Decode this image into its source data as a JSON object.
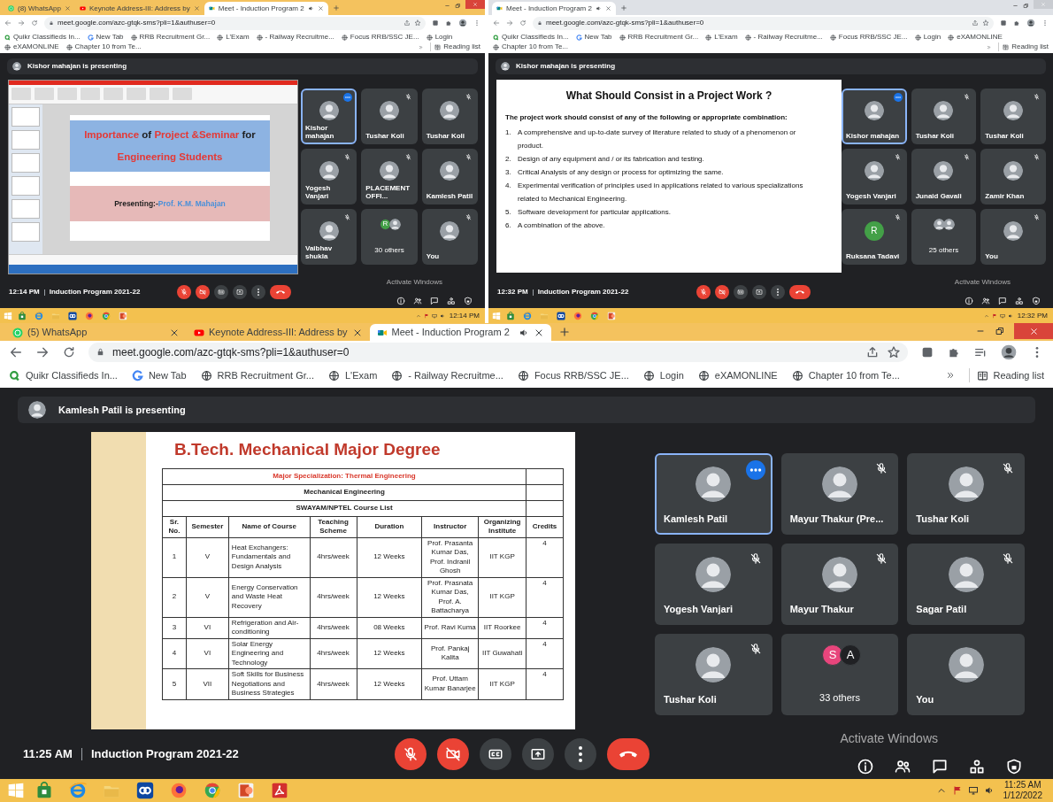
{
  "panels": [
    {
      "tabs": [
        {
          "title": "(8) WhatsApp",
          "kind": "whatsapp",
          "selected": false,
          "audio": false
        },
        {
          "title": "Keynote Address-III: Address by",
          "kind": "youtube",
          "selected": false,
          "audio": false
        },
        {
          "title": "Meet - Induction Program 2",
          "kind": "meet",
          "selected": true,
          "audio": true
        }
      ],
      "url": "meet.google.com/azc-gtqk-sms?pli=1&authuser=0",
      "bookmarks": [
        {
          "label": "Quikr Classifieds In...",
          "kind": "quikr"
        },
        {
          "label": "New Tab",
          "kind": "google"
        },
        {
          "label": "RRB Recruitment Gr...",
          "kind": "globe"
        },
        {
          "label": "L'Exam",
          "kind": "globe"
        },
        {
          "label": "- Railway Recruitme...",
          "kind": "globe"
        },
        {
          "label": "Focus RRB/SSC JE...",
          "kind": "globe"
        },
        {
          "label": "Login",
          "kind": "globe"
        },
        {
          "label": "eXAMONLINE",
          "kind": "globe"
        },
        {
          "label": "Chapter 10 from Te...",
          "kind": "globe"
        }
      ],
      "reading_list": "Reading list",
      "presenter": "Kishor mahajan is presenting",
      "slide": {
        "kind": "title",
        "title_lines": [
          [
            {
              "text": "Importance",
              "color": "#e53935"
            },
            {
              "text": "of",
              "color": "#1f1f1f"
            },
            {
              "text": "Project",
              "color": "#e53935"
            },
            {
              "text": "&Seminar",
              "color": "#e53935"
            },
            {
              "text": "for",
              "color": "#1f1f1f"
            }
          ],
          [
            {
              "text": "Engineering Students",
              "color": "#e53935"
            }
          ]
        ],
        "subtitle": [
          {
            "text": "Presenting:-",
            "color": "#1f1f1f"
          },
          {
            "text": "Prof. K.M. Mahajan",
            "color": "#4a90d9"
          }
        ]
      },
      "tiles": [
        {
          "kind": "photo",
          "name": "Kishor mahajan",
          "speaking": true,
          "muted": false
        },
        {
          "kind": "photo",
          "name": "Tushar Koli",
          "speaking": false,
          "muted": true
        },
        {
          "kind": "photo",
          "name": "Tushar Koli",
          "speaking": false,
          "muted": true
        },
        {
          "kind": "photo",
          "name": "Yogesh Vanjari",
          "speaking": false,
          "muted": true
        },
        {
          "kind": "photo",
          "name": "PLACEMENT OFFI...",
          "speaking": false,
          "muted": true
        },
        {
          "kind": "photo",
          "name": "Kamlesh Patil",
          "speaking": false,
          "muted": true
        },
        {
          "kind": "photo",
          "name": "Vaibhav shukla",
          "speaking": false,
          "muted": true
        },
        {
          "kind": "others",
          "name": "30 others",
          "speaking": false,
          "muted": false,
          "avatars": [
            {
              "kind": "letter",
              "letter": "R",
              "color": "#43a047"
            },
            {
              "kind": "photo"
            }
          ]
        },
        {
          "kind": "photo",
          "name": "You",
          "speaking": false,
          "muted": true
        }
      ],
      "time": "12:14 PM",
      "meeting": "Induction Program 2021-22",
      "mic_on": false,
      "camera_on": false,
      "activation": "Activate Windows",
      "taskbar": {
        "clock": "12:14 PM"
      }
    },
    {
      "tabs": [
        {
          "title": "Meet - Induction Program 2",
          "kind": "meet",
          "selected": true,
          "audio": true
        }
      ],
      "url": "meet.google.com/azc-gtqk-sms?pli=1&authuser=0",
      "bookmarks": [
        {
          "label": "Quikr Classifieds In...",
          "kind": "quikr"
        },
        {
          "label": "New Tab",
          "kind": "google"
        },
        {
          "label": "RRB Recruitment Gr...",
          "kind": "globe"
        },
        {
          "label": "L'Exam",
          "kind": "globe"
        },
        {
          "label": "- Railway Recruitme...",
          "kind": "globe"
        },
        {
          "label": "Focus RRB/SSC JE...",
          "kind": "globe"
        },
        {
          "label": "Login",
          "kind": "globe"
        },
        {
          "label": "eXAMONLINE",
          "kind": "globe"
        },
        {
          "label": "Chapter 10 from Te...",
          "kind": "globe"
        }
      ],
      "reading_list": "Reading list",
      "presenter": "Kishor mahajan is presenting",
      "slide": {
        "kind": "bullets",
        "title": "What Should Consist in a Project Work ?",
        "intro": "The project work should consist of any of the following or appropriate combination:",
        "items": [
          {
            "number": "1.",
            "text": "A comprehensive and up-to-date survey of literature related to study of a phenomenon or product."
          },
          {
            "number": "2.",
            "text": "Design of any equipment and / or its fabrication and testing."
          },
          {
            "number": "3.",
            "text": "Critical Analysis of any design or process for optimizing the same."
          },
          {
            "number": "4.",
            "text": "Experimental verification of principles used in applications related to various specializations related to Mechanical Engineering."
          },
          {
            "number": "5.",
            "text": "Software development for particular applications."
          },
          {
            "number": "6.",
            "text": "A combination of the above."
          }
        ]
      },
      "tiles": [
        {
          "kind": "photo",
          "name": "Kishor mahajan",
          "speaking": true,
          "muted": false
        },
        {
          "kind": "photo",
          "name": "Tushar Koli",
          "speaking": false,
          "muted": true
        },
        {
          "kind": "photo",
          "name": "Tushar Koli",
          "speaking": false,
          "muted": true
        },
        {
          "kind": "photo",
          "name": "Yogesh Vanjari",
          "speaking": false,
          "muted": true
        },
        {
          "kind": "photo",
          "name": "Junaid Gavali",
          "speaking": false,
          "muted": true
        },
        {
          "kind": "photo",
          "name": "Zamir Khan",
          "speaking": false,
          "muted": true
        },
        {
          "kind": "letter",
          "letter": "R",
          "color": "#43a047",
          "name": "Ruksana Tadavi",
          "speaking": false,
          "muted": true
        },
        {
          "kind": "others",
          "name": "25 others",
          "speaking": false,
          "muted": false,
          "avatars": [
            {
              "kind": "photo"
            },
            {
              "kind": "photo"
            }
          ]
        },
        {
          "kind": "photo",
          "name": "You",
          "speaking": false,
          "muted": true
        }
      ],
      "time": "12:32 PM",
      "meeting": "Induction Program 2021-22",
      "mic_on": false,
      "camera_on": false,
      "activation": "Activate Windows",
      "taskbar": {
        "clock": "12:32 PM"
      }
    },
    {
      "tabs": [
        {
          "title": "(5) WhatsApp",
          "kind": "whatsapp",
          "selected": false,
          "audio": false
        },
        {
          "title": "Keynote Address-III: Address by",
          "kind": "youtube",
          "selected": false,
          "audio": false
        },
        {
          "title": "Meet - Induction Program 2",
          "kind": "meet",
          "selected": true,
          "audio": true
        }
      ],
      "url": "meet.google.com/azc-gtqk-sms?pli=1&authuser=0",
      "bookmarks": [
        {
          "label": "Quikr Classifieds In...",
          "kind": "quikr"
        },
        {
          "label": "New Tab",
          "kind": "google"
        },
        {
          "label": "RRB Recruitment Gr...",
          "kind": "globe"
        },
        {
          "label": "L'Exam",
          "kind": "globe"
        },
        {
          "label": "- Railway Recruitme...",
          "kind": "globe"
        },
        {
          "label": "Focus RRB/SSC JE...",
          "kind": "globe"
        },
        {
          "label": "Login",
          "kind": "globe"
        },
        {
          "label": "eXAMONLINE",
          "kind": "globe"
        },
        {
          "label": "Chapter 10 from Te...",
          "kind": "globe"
        }
      ],
      "reading_list": "Reading list",
      "presenter": "Kamlesh Patil is presenting",
      "slide": {
        "kind": "table",
        "title": "B.Tech. Mechanical Major Degree",
        "banners": [
          "Major Specialization: Thermal Engineering",
          "Mechanical Engineering",
          "SWAYAM/NPTEL Course List"
        ],
        "columns": [
          "Sr. No.",
          "Semester",
          "Name of Course",
          "Teaching Scheme",
          "Duration",
          "Instructor",
          "Organizing Institute",
          "Credits"
        ],
        "rows": [
          [
            "1",
            "V",
            "Heat Exchangers: Fundamentals and Design Analysis",
            "4hrs/week",
            "12 Weeks",
            "Prof. Prasanta Kumar Das, Prof. Indranil Ghosh",
            "IIT KGP",
            "4"
          ],
          [
            "2",
            "V",
            "Energy Conservation and Waste Heat Recovery",
            "4hrs/week",
            "12 Weeks",
            "Prof. Prasnata Kumar Das, Prof. A. Battacharya",
            "IIT KGP",
            "4"
          ],
          [
            "3",
            "VI",
            "Refrigeration and Air-conditioning",
            "4hrs/week",
            "08 Weeks",
            "Prof. Ravi Kuma",
            "IIT Roorkee",
            "4"
          ],
          [
            "4",
            "VI",
            "Solar Energy Engineering and Technology",
            "4hrs/week",
            "12 Weeks",
            "Prof. Pankaj Kalita",
            "IIT Guwahati",
            "4"
          ],
          [
            "5",
            "VII",
            "Soft Skills for Business Negotiations and Business Strategies",
            "4hrs/week",
            "12 Weeks",
            "Prof. Uttam Kumar Banarjee",
            "IIT KGP",
            "4"
          ]
        ]
      },
      "tiles": [
        {
          "kind": "photo",
          "name": "Kamlesh Patil",
          "speaking": true,
          "muted": false
        },
        {
          "kind": "photo",
          "name": "Mayur Thakur (Pre...",
          "speaking": false,
          "muted": true
        },
        {
          "kind": "photo",
          "name": "Tushar Koli",
          "speaking": false,
          "muted": true
        },
        {
          "kind": "photo",
          "name": "Yogesh Vanjari",
          "speaking": false,
          "muted": true
        },
        {
          "kind": "photo",
          "name": "Mayur Thakur",
          "speaking": false,
          "muted": true
        },
        {
          "kind": "photo",
          "name": "Sagar Patil",
          "speaking": false,
          "muted": true
        },
        {
          "kind": "photo",
          "name": "Tushar Koli",
          "speaking": false,
          "muted": true
        },
        {
          "kind": "others",
          "name": "33 others",
          "speaking": false,
          "muted": false,
          "avatars": [
            {
              "kind": "letter",
              "letter": "S",
              "color": "#e8457c"
            },
            {
              "kind": "letter",
              "letter": "A",
              "color": "#202124"
            }
          ]
        },
        {
          "kind": "photo",
          "name": "You",
          "speaking": false,
          "muted": false
        }
      ],
      "time": "11:25 AM",
      "meeting": "Induction Program 2021-22",
      "mic_on": false,
      "camera_on": false,
      "activation": "Activate Windows",
      "taskbar": {
        "clock": "11:25 AM",
        "date": "1/12/2022"
      }
    }
  ]
}
